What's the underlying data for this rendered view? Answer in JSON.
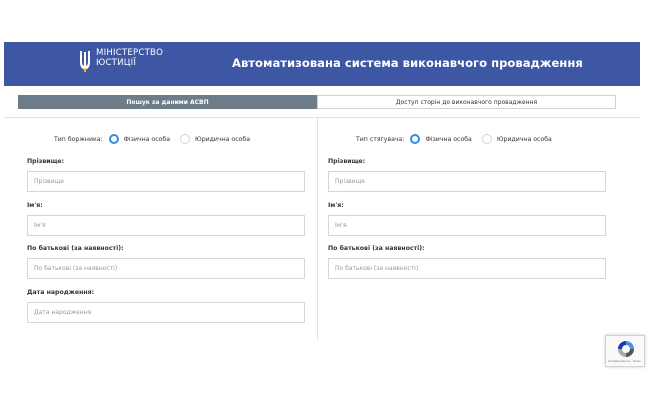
{
  "header": {
    "logo_line1": "МІНІСТЕРСТВО",
    "logo_line2": "ЮСТИЦІЇ",
    "title": "Автоматизована система виконавчого провадження",
    "background": "#3d57a4"
  },
  "tabs": [
    {
      "label": "Пошук за даними АСВП",
      "active": true
    },
    {
      "label": "Доступ сторін до виконавчого провадження",
      "active": false
    }
  ],
  "left": {
    "type_label": "Тип боржника:",
    "radio_individual": "Фізична особа",
    "radio_legal": "Юридична особа",
    "surname_label": "Прізвище:",
    "surname_placeholder": "Прізвище",
    "name_label": "Ім'я:",
    "name_placeholder": "Ім'я",
    "patronymic_label": "По батькові (за наявності):",
    "patronymic_placeholder": "По батькові (за наявності)",
    "birthdate_label": "Дата народження:",
    "birthdate_placeholder": "Дата народження"
  },
  "right": {
    "type_label": "Тип стягувача:",
    "radio_individual": "Фізична особа",
    "radio_legal": "Юридична особа",
    "surname_label": "Прізвище:",
    "surname_placeholder": "Прізвище",
    "name_label": "Ім'я:",
    "name_placeholder": "Ім'я",
    "patronymic_label": "По батькові (за наявності):",
    "patronymic_placeholder": "По батькові (за наявності)"
  },
  "recaptcha": {
    "text": "Конфіденційність - Умови"
  },
  "colors": {
    "accent_radio": "#2f8de4",
    "active_tab": "#6e7b88"
  }
}
